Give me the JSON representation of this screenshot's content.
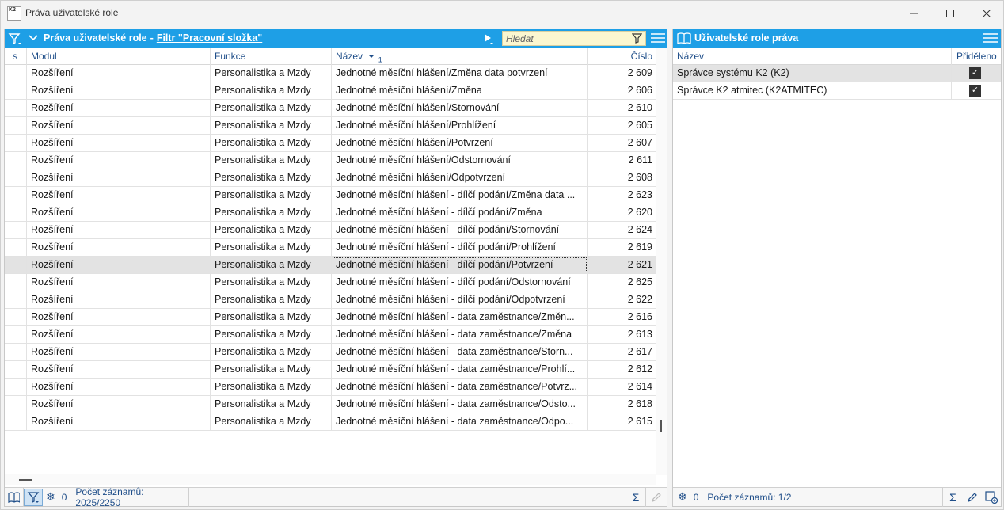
{
  "window": {
    "title": "Práva uživatelské role",
    "logo_text": "K2"
  },
  "left_panel": {
    "title": "Práva uživatelské role",
    "separator": "-",
    "filter_text": "Filtr \"Pracovní složka\"",
    "search_placeholder": "Hledat",
    "columns": {
      "s": "s",
      "modul": "Modul",
      "funkce": "Funkce",
      "nazev": "Název",
      "nazev_sort_order": "1",
      "cislo": "Číslo"
    },
    "rows": [
      {
        "modul": "Rozšíření",
        "funkce": "Personalistika a Mzdy",
        "nazev": "Jednotné měsíční hlášení/Změna data potvrzení",
        "cislo": "2 609"
      },
      {
        "modul": "Rozšíření",
        "funkce": "Personalistika a Mzdy",
        "nazev": "Jednotné měsíční hlášení/Změna",
        "cislo": "2 606"
      },
      {
        "modul": "Rozšíření",
        "funkce": "Personalistika a Mzdy",
        "nazev": "Jednotné měsíční hlášení/Stornování",
        "cislo": "2 610"
      },
      {
        "modul": "Rozšíření",
        "funkce": "Personalistika a Mzdy",
        "nazev": "Jednotné měsíční hlášení/Prohlížení",
        "cislo": "2 605"
      },
      {
        "modul": "Rozšíření",
        "funkce": "Personalistika a Mzdy",
        "nazev": "Jednotné měsíční hlášení/Potvrzení",
        "cislo": "2 607"
      },
      {
        "modul": "Rozšíření",
        "funkce": "Personalistika a Mzdy",
        "nazev": "Jednotné měsíční hlášení/Odstornování",
        "cislo": "2 611"
      },
      {
        "modul": "Rozšíření",
        "funkce": "Personalistika a Mzdy",
        "nazev": "Jednotné měsíční hlášení/Odpotvrzení",
        "cislo": "2 608"
      },
      {
        "modul": "Rozšíření",
        "funkce": "Personalistika a Mzdy",
        "nazev": "Jednotné měsíční hlášení - dílčí podání/Změna data ...",
        "cislo": "2 623"
      },
      {
        "modul": "Rozšíření",
        "funkce": "Personalistika a Mzdy",
        "nazev": "Jednotné měsíční hlášení - dílčí podání/Změna",
        "cislo": "2 620"
      },
      {
        "modul": "Rozšíření",
        "funkce": "Personalistika a Mzdy",
        "nazev": "Jednotné měsíční hlášení - dílčí podání/Stornování",
        "cislo": "2 624"
      },
      {
        "modul": "Rozšíření",
        "funkce": "Personalistika a Mzdy",
        "nazev": "Jednotné měsíční hlášení - dílčí podání/Prohlížení",
        "cislo": "2 619"
      },
      {
        "modul": "Rozšíření",
        "funkce": "Personalistika a Mzdy",
        "nazev": "Jednotné měsíční hlášení - dílčí podání/Potvrzení",
        "cislo": "2 621"
      },
      {
        "modul": "Rozšíření",
        "funkce": "Personalistika a Mzdy",
        "nazev": "Jednotné měsíční hlášení - dílčí podání/Odstornování",
        "cislo": "2 625"
      },
      {
        "modul": "Rozšíření",
        "funkce": "Personalistika a Mzdy",
        "nazev": "Jednotné měsíční hlášení - dílčí podání/Odpotvrzení",
        "cislo": "2 622"
      },
      {
        "modul": "Rozšíření",
        "funkce": "Personalistika a Mzdy",
        "nazev": "Jednotné měsíční hlášení - data zaměstnance/Změn...",
        "cislo": "2 616"
      },
      {
        "modul": "Rozšíření",
        "funkce": "Personalistika a Mzdy",
        "nazev": "Jednotné měsíční hlášení - data zaměstnance/Změna",
        "cislo": "2 613"
      },
      {
        "modul": "Rozšíření",
        "funkce": "Personalistika a Mzdy",
        "nazev": "Jednotné měsíční hlášení - data zaměstnance/Storn...",
        "cislo": "2 617"
      },
      {
        "modul": "Rozšíření",
        "funkce": "Personalistika a Mzdy",
        "nazev": "Jednotné měsíční hlášení - data zaměstnance/Prohlí...",
        "cislo": "2 612"
      },
      {
        "modul": "Rozšíření",
        "funkce": "Personalistika a Mzdy",
        "nazev": "Jednotné měsíční hlášení - data zaměstnance/Potvrz...",
        "cislo": "2 614"
      },
      {
        "modul": "Rozšíření",
        "funkce": "Personalistika a Mzdy",
        "nazev": "Jednotné měsíční hlášení - data zaměstnance/Odsto...",
        "cislo": "2 618"
      },
      {
        "modul": "Rozšíření",
        "funkce": "Personalistika a Mzdy",
        "nazev": "Jednotné měsíční hlášení - data zaměstnance/Odpo...",
        "cislo": "2 615"
      }
    ],
    "selected_row": 11,
    "status": {
      "frozen_count": "0",
      "record_count": "Počet záznamů: 2025/2250"
    }
  },
  "right_panel": {
    "title": "Uživatelské role práva",
    "columns": {
      "nazev": "Název",
      "prideleno": "Přiděleno"
    },
    "rows": [
      {
        "nazev": "Správce systému K2 (K2)",
        "prideleno": true
      },
      {
        "nazev": "Správce K2 atmitec (K2ATMITEC)",
        "prideleno": true
      }
    ],
    "selected_row": 0,
    "status": {
      "frozen_count": "0",
      "record_count": "Počet záznamů: 1/2"
    }
  },
  "colors": {
    "accent": "#1e9fe6",
    "header_text": "#1f4e89",
    "selected_row": "#e3e3e3",
    "search_bg": "#fbf7d0"
  }
}
